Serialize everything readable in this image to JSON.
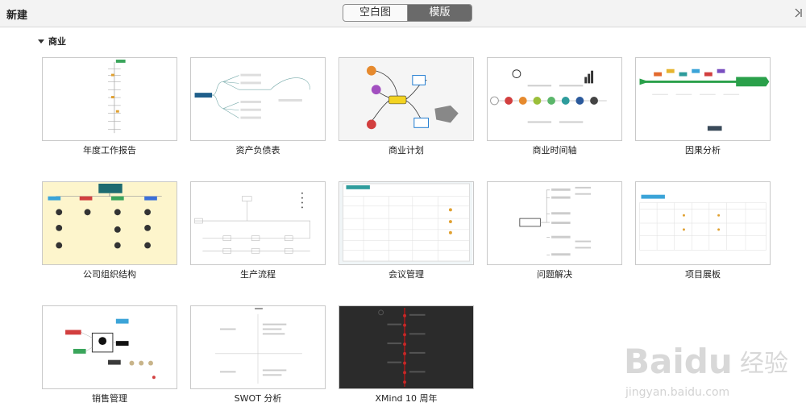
{
  "header": {
    "title": "新建",
    "tabs": [
      "空白图",
      "模版"
    ],
    "active_tab": "模版"
  },
  "section": {
    "label": "商业"
  },
  "templates": [
    {
      "label": "年度工作报告",
      "icon": "mindmap-vertical-thumbnail"
    },
    {
      "label": "资产负债表",
      "icon": "mindmap-tree-thumbnail"
    },
    {
      "label": "商业计划",
      "icon": "mindmap-colorful-thumbnail"
    },
    {
      "label": "商业时间轴",
      "icon": "timeline-thumbnail"
    },
    {
      "label": "因果分析",
      "icon": "fishbone-thumbnail"
    },
    {
      "label": "公司组织结构",
      "icon": "org-chart-thumbnail"
    },
    {
      "label": "生产流程",
      "icon": "flowchart-thumbnail"
    },
    {
      "label": "会议管理",
      "icon": "table-thumbnail"
    },
    {
      "label": "问题解决",
      "icon": "logic-chart-thumbnail"
    },
    {
      "label": "项目展板",
      "icon": "table-board-thumbnail"
    },
    {
      "label": "销售管理",
      "icon": "mindmap-sales-thumbnail"
    },
    {
      "label": "SWOT 分析",
      "icon": "matrix-thumbnail"
    },
    {
      "label": "XMind 10 周年",
      "icon": "dark-timeline-thumbnail"
    }
  ],
  "watermark": {
    "brand": "Baidu",
    "brand_cn": "经验",
    "url": "jingyan.baidu.com"
  },
  "colors": {
    "accent_gray": "#6a6a6a",
    "org_bg": "#fdf5cc",
    "dark_bg": "#2b2b2b",
    "teal": "#1e6b70"
  }
}
